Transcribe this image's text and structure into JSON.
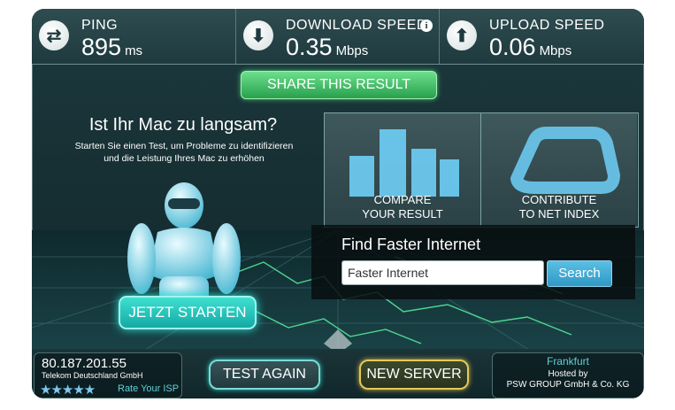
{
  "metrics": {
    "ping": {
      "label": "PING",
      "value": "895",
      "unit": "ms",
      "icon": "ping-arrows-icon"
    },
    "download": {
      "label": "DOWNLOAD SPEED",
      "value": "0.35",
      "unit": "Mbps",
      "icon": "download-arrow-icon",
      "info": "i"
    },
    "upload": {
      "label": "UPLOAD SPEED",
      "value": "0.06",
      "unit": "Mbps",
      "icon": "upload-arrow-icon"
    }
  },
  "share_label": "SHARE THIS RESULT",
  "ad": {
    "title": "Ist Ihr Mac zu langsam?",
    "subtitle_line1": "Starten Sie einen Test, um Probleme zu  identifizieren",
    "subtitle_line2": "und die Leistung Ihres Mac zu erhöhen",
    "button": "JETZT STARTEN"
  },
  "tiles": {
    "compare": {
      "line1": "COMPARE",
      "line2": "YOUR RESULT"
    },
    "contribute": {
      "line1": "CONTRIBUTE",
      "line2": "TO NET INDEX"
    }
  },
  "find": {
    "title": "Find Faster Internet",
    "input_value": "Faster Internet",
    "search_label": "Search"
  },
  "footer": {
    "ip": "80.187.201.55",
    "isp": "Telekom Deutschland GmbH",
    "stars": "★★★★★",
    "rate_label": "Rate Your ISP",
    "test_again": "TEST AGAIN",
    "new_server": "NEW SERVER",
    "server_city": "Frankfurt",
    "hosted_line1": "Hosted by",
    "hosted_line2": "PSW GROUP GmbH & Co. KG"
  },
  "colors": {
    "accent_green": "#27a04d",
    "accent_teal": "#14a9a4",
    "accent_gold": "#e3c95a",
    "search_blue": "#2f98c4"
  }
}
